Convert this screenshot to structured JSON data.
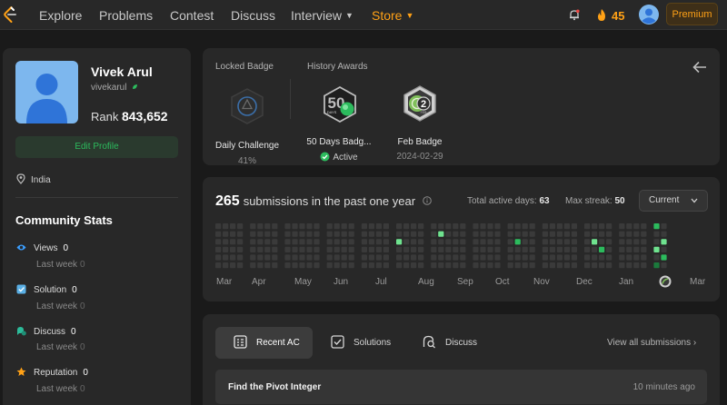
{
  "nav": {
    "items": [
      "Explore",
      "Problems",
      "Contest",
      "Discuss",
      "Interview",
      "Store"
    ],
    "streak": "45",
    "premium_label": "Premium"
  },
  "profile": {
    "display_name": "Vivek Arul",
    "username": "vivekarul",
    "rank_label": "Rank",
    "rank_value": "843,652",
    "edit_label": "Edit Profile",
    "location": "India"
  },
  "community": {
    "title": "Community Stats",
    "stats": [
      {
        "label": "Views",
        "value": "0",
        "sub_label": "Last week",
        "sub_value": "0",
        "icon": "eye-icon",
        "color": "#3b9eff"
      },
      {
        "label": "Solution",
        "value": "0",
        "sub_label": "Last week",
        "sub_value": "0",
        "icon": "solution-icon",
        "color": "#5ab0e6"
      },
      {
        "label": "Discuss",
        "value": "0",
        "sub_label": "Last week",
        "sub_value": "0",
        "icon": "discuss-icon",
        "color": "#2cbb9a"
      },
      {
        "label": "Reputation",
        "value": "0",
        "sub_label": "Last week",
        "sub_value": "0",
        "icon": "star-icon",
        "color": "#ffa116"
      }
    ]
  },
  "badges": {
    "locked_title": "Locked Badge",
    "history_title": "History Awards",
    "locked": {
      "name": "Daily Challenge",
      "progress": "41%"
    },
    "history": [
      {
        "name": "50 Days Badg...",
        "status": "Active"
      },
      {
        "name": "Feb Badge",
        "date": "2024-02-29"
      }
    ],
    "icon_texts": {
      "days_number": "50",
      "days_label": "DAYS",
      "feb_number": "2",
      "feb_label": "FEB"
    }
  },
  "submissions": {
    "count": "265",
    "text": "submissions in the past one year",
    "active_days_label": "Total active days:",
    "active_days": "63",
    "max_streak_label": "Max streak:",
    "max_streak": "50",
    "dropdown": "Current",
    "months": [
      "Mar",
      "Apr",
      "May",
      "Jun",
      "Jul",
      "Aug",
      "Sep",
      "Oct",
      "Nov",
      "Dec",
      "Jan",
      "Mar"
    ]
  },
  "recent": {
    "tabs": [
      "Recent AC",
      "Solutions",
      "Discuss"
    ],
    "view_all": "View all submissions",
    "items": [
      {
        "title": "Find the Pivot Integer",
        "time": "10 minutes ago"
      }
    ]
  },
  "colors": {
    "accent": "#ffa116",
    "green": "#2cbb5d",
    "card": "#282828",
    "bg": "#1a1a1a"
  }
}
